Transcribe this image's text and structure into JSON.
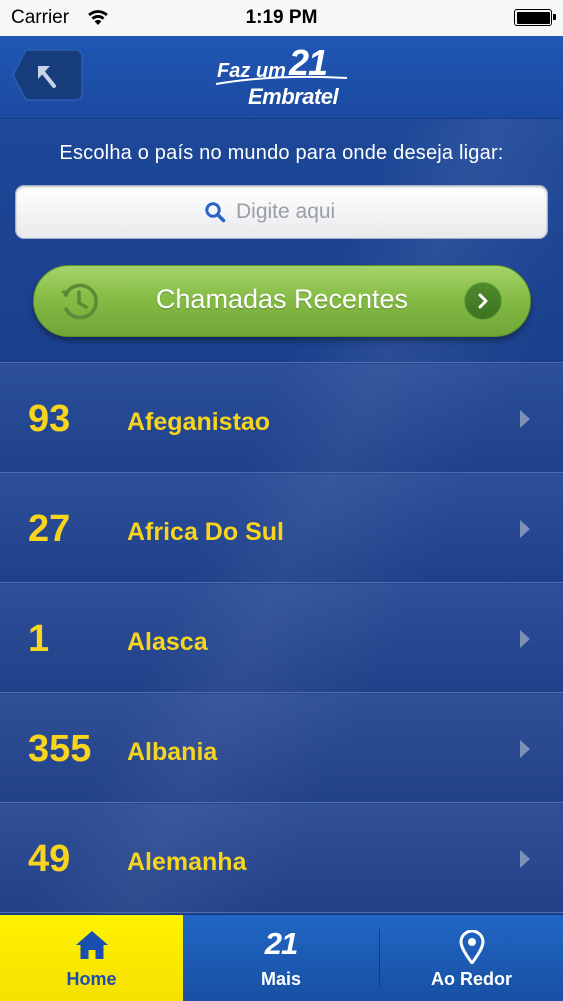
{
  "status_bar": {
    "carrier": "Carrier",
    "time": "1:19 PM",
    "battery_percent": 100
  },
  "header": {
    "back_icon": "back-arrow-icon",
    "logo": {
      "line1": "Faz um",
      "number": "21",
      "line2": "Embratel"
    }
  },
  "prompt": "Escolha o país no mundo para onde deseja ligar:",
  "search": {
    "placeholder": "Digite aqui",
    "icon": "search-icon"
  },
  "recent_calls": {
    "label": "Chamadas Recentes",
    "icon": "clock-icon"
  },
  "countries": [
    {
      "code": "93",
      "name": "Afeganistao"
    },
    {
      "code": "27",
      "name": "Africa Do Sul"
    },
    {
      "code": "1",
      "name": "Alasca"
    },
    {
      "code": "355",
      "name": "Albania"
    },
    {
      "code": "49",
      "name": "Alemanha"
    }
  ],
  "tab_bar": {
    "home": {
      "label": "Home",
      "icon": "home-icon",
      "selected": true
    },
    "mais": {
      "label": "Mais",
      "icon_text": "21"
    },
    "ao_redor": {
      "label": "Ao Redor",
      "icon": "location-pin-icon"
    }
  },
  "colors": {
    "accent_yellow": "#f7d41d",
    "header_blue": "#1f57b5",
    "button_green": "#86bd46",
    "tab_selected": "#fff200"
  }
}
